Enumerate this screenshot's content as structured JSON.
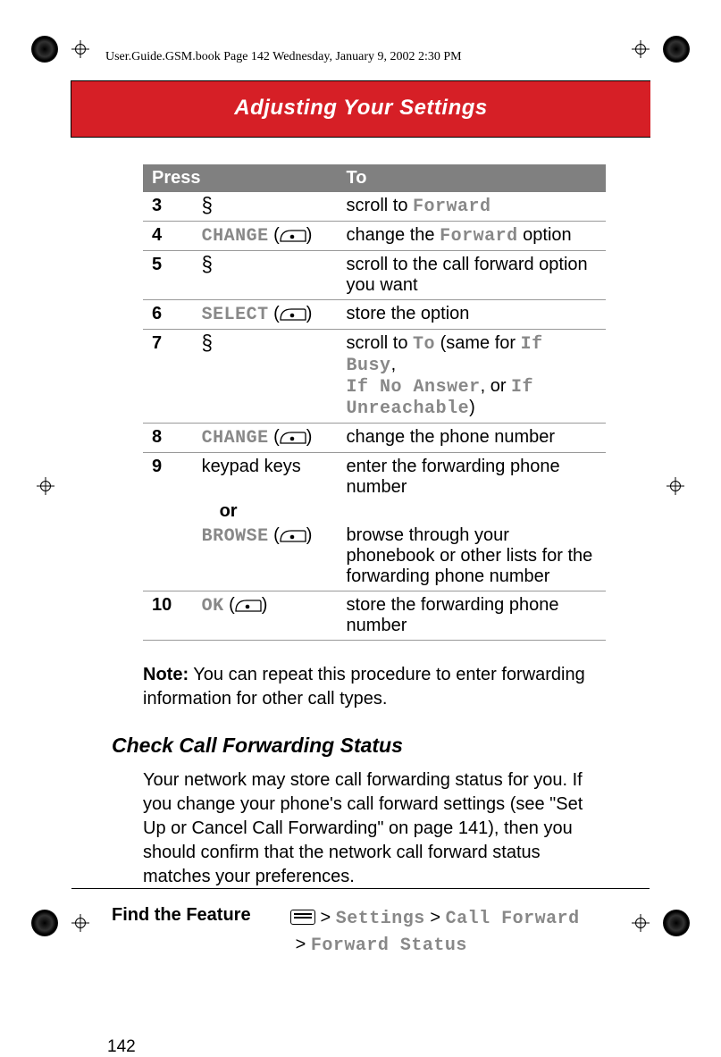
{
  "meta_header": "User.Guide.GSM.book  Page 142  Wednesday, January 9, 2002  2:30 PM",
  "chapter_title": "Adjusting Your Settings",
  "page_number": "142",
  "table": {
    "header_press": "Press",
    "header_to": "To",
    "rows": {
      "r3": {
        "n": "3",
        "press_icon": "S",
        "to_pre": "scroll to ",
        "to_mono": "Forward"
      },
      "r4": {
        "n": "4",
        "press_mono": "CHANGE",
        "press_suffix": " (",
        "press_suffix2": ")",
        "to_pre": "change the ",
        "to_mono": "Forward",
        "to_post": " option"
      },
      "r5": {
        "n": "5",
        "press_icon": "S",
        "to": "scroll to the call forward option you want"
      },
      "r6": {
        "n": "6",
        "press_mono": "SELECT",
        "to": "store the option"
      },
      "r7": {
        "n": "7",
        "press_icon": "S",
        "to_pre": "scroll to ",
        "to_mono1": "To",
        "to_mid1": " (same for ",
        "to_mono2": "If Busy",
        "to_comma": ", ",
        "to_mono3": "If No Answer",
        "to_mid2": ", or ",
        "to_mono4": "If Unreachable",
        "to_end": ")"
      },
      "r8": {
        "n": "8",
        "press_mono": "CHANGE",
        "to": "change the phone number"
      },
      "r9a": {
        "n": "9",
        "press": "keypad keys",
        "to": "enter the forwarding phone number"
      },
      "r9or": {
        "or": "or"
      },
      "r9b": {
        "press_mono": "BROWSE",
        "to": "browse through your phonebook or other lists for the forwarding phone number"
      },
      "r10": {
        "n": "10",
        "press_mono": " OK",
        "to": "store the forwarding phone number"
      }
    }
  },
  "note_label": "Note:",
  "note_text": " You can repeat this procedure to enter forwarding information for other call types.",
  "subsection": "Check Call Forwarding Status",
  "paragraph": "Your network may store call forwarding status for you. If you change your phone's call forward settings (see \"Set Up or Cancel Call Forwarding\" on page 141), then you should confirm that the network call forward status matches your preferences.",
  "find_feature_label": "Find the Feature",
  "nav": {
    "gt1": " > ",
    "settings": "Settings",
    "gt2": " > ",
    "call_forward": "Call Forward",
    "gt3": "> ",
    "forward_status": "Forward Status"
  }
}
